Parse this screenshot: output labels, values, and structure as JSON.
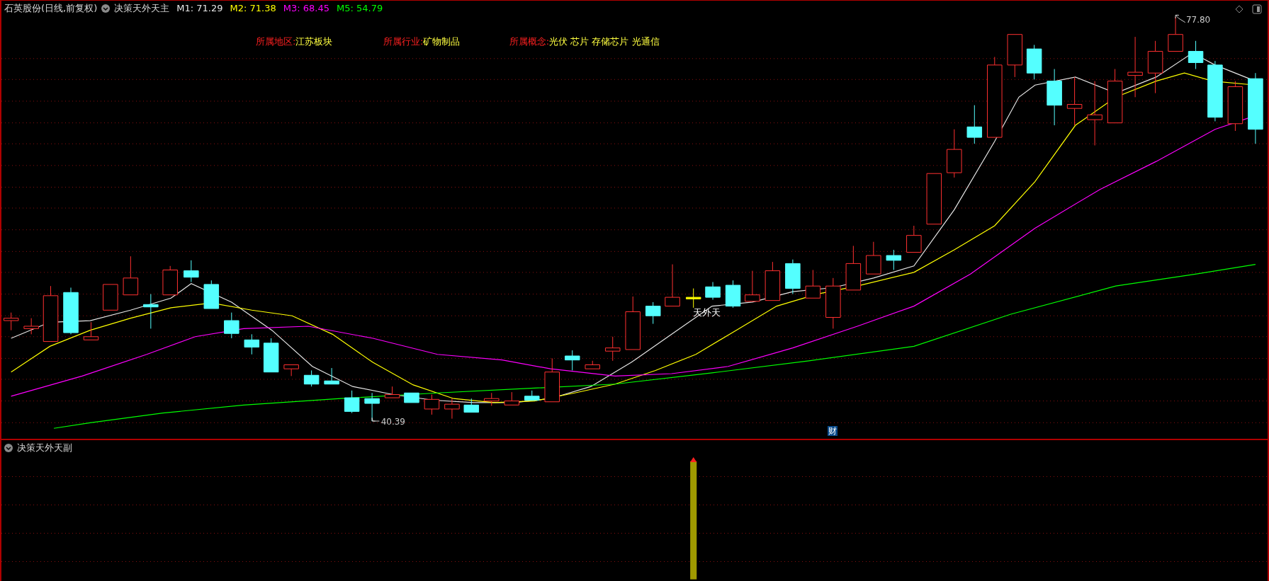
{
  "main_panel": {
    "security": "石英股份(日线,前复权)",
    "indicator": "决策天外天主",
    "ma_readings": [
      {
        "label": "M1:",
        "value": "71.29",
        "color": "#e6e6e6"
      },
      {
        "label": "M2:",
        "value": "71.38",
        "color": "#ffff00"
      },
      {
        "label": "M3:",
        "value": "68.45",
        "color": "#ff00ff"
      },
      {
        "label": "M5:",
        "value": "54.79",
        "color": "#00ff00"
      }
    ],
    "info": [
      {
        "label": "所属地区:",
        "value": "江苏板块"
      },
      {
        "label": "所属行业:",
        "value": "矿物制品"
      },
      {
        "label": "所属概念:",
        "value": "光伏 芯片 存储芯片 光通信"
      }
    ],
    "high_label": "77.80",
    "low_label": "40.39",
    "signal_label": "天外天",
    "finance_badge": "财"
  },
  "sub_panel": {
    "indicator": "决策天外天副"
  }
}
